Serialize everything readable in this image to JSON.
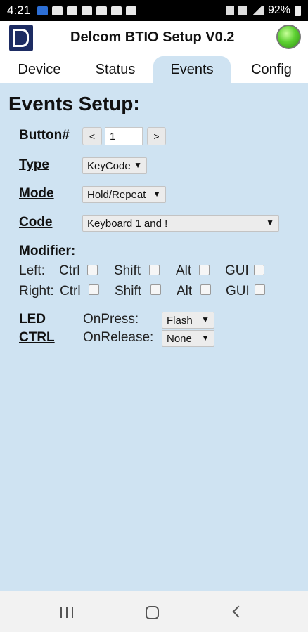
{
  "status_bar": {
    "time": "4:21",
    "battery": "92%"
  },
  "app": {
    "title": "Delcom BTIO Setup V0.2"
  },
  "tabs": [
    {
      "label": "Device"
    },
    {
      "label": "Status"
    },
    {
      "label": "Events"
    },
    {
      "label": "Config"
    }
  ],
  "active_tab": "Events",
  "events": {
    "heading": "Events Setup:",
    "button": {
      "label": "Button#",
      "prev": "<",
      "value": "1",
      "next": ">"
    },
    "type": {
      "label": "Type",
      "selected": "KeyCode"
    },
    "mode": {
      "label": "Mode",
      "selected": "Hold/Repeat"
    },
    "code": {
      "label": "Code",
      "selected": "Keyboard 1 and !"
    },
    "modifier": {
      "label": "Modifier:",
      "left_label": "Left:",
      "right_label": "Right:",
      "ctrl": "Ctrl",
      "shift": "Shift",
      "alt": "Alt",
      "gui": "GUI"
    },
    "led_ctrl": {
      "label_line1": "LED",
      "label_line2": "CTRL",
      "onpress_label": "OnPress:",
      "onpress_selected": "Flash",
      "onrelease_label": "OnRelease:",
      "onrelease_selected": "None"
    }
  }
}
